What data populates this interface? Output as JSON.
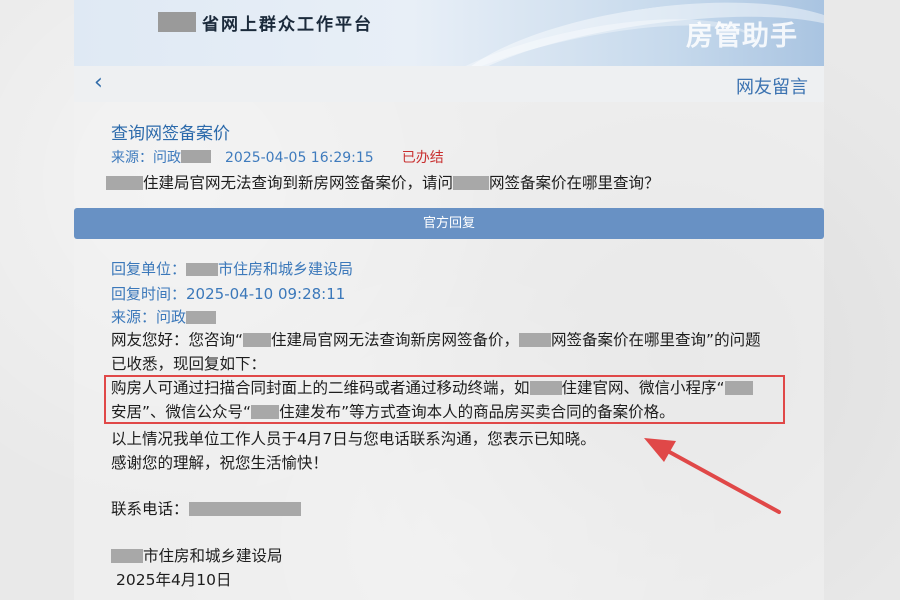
{
  "header": {
    "platform_title": "省网上群众工作平台",
    "brand": "房管助手"
  },
  "subnav": {
    "back_glyph": "‹",
    "page_label": "网友留言"
  },
  "question": {
    "title": "查询网签备案价",
    "source_label": "来源：问政",
    "datetime": "2025-04-05 16:29:15",
    "status": "已办结",
    "text_part1": "住建局官网无法查询到新房网签备案价，请问",
    "text_part2": "网签备案价在哪里查询？"
  },
  "reply_bar_label": "官方回复",
  "reply": {
    "unit_label": "回复单位：",
    "unit_value": "市住房和城乡建设局",
    "time_label": "回复时间：",
    "time_value": "2025-04-10 09:28:11",
    "source_label": "来源：问政",
    "line1_a": "网友您好：您咨询“",
    "line1_b": "住建局官网无法查询新房网签备价，",
    "line1_c": "网签备案价在哪里查询”的问题",
    "line2": "已收悉，现回复如下：",
    "line3_a": "购房人可通过扫描合同封面上的二维码或者通过移动终端，如",
    "line3_b": "住建官网、微信小程序“",
    "line4_a": "安居”、微信公众号“",
    "line4_b": "住建发布”等方式查询本人的商品房买卖合同的备案价格。",
    "line5": "以上情况我单位工作人员于4月7日与您电话联系沟通，您表示已知晓。",
    "line6": "感谢您的理解，祝您生活愉快！",
    "phone_label": "联系电话：",
    "sign_org": "市住房和城乡建设局",
    "sign_date": "2025年4月10日"
  },
  "colors": {
    "accent_blue": "#3b78ba",
    "reply_bar": "#6891c4",
    "status_red": "#c93030",
    "highlight_red": "#e04848"
  }
}
